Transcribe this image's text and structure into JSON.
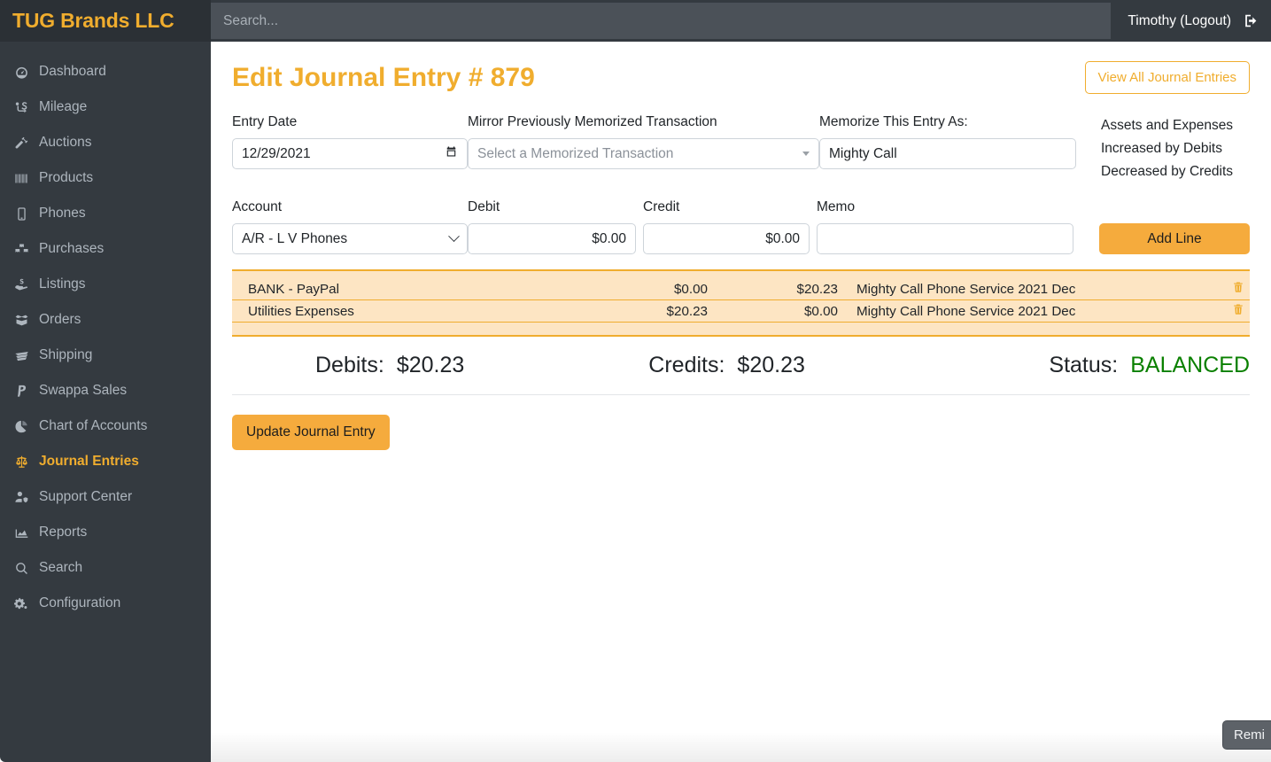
{
  "brand": {
    "name": "TUG Brands LLC"
  },
  "sidebar": {
    "items": [
      {
        "label": "Dashboard",
        "icon": "gauge-icon",
        "active": false
      },
      {
        "label": "Mileage",
        "icon": "route-icon",
        "active": false
      },
      {
        "label": "Auctions",
        "icon": "gavel-icon",
        "active": false
      },
      {
        "label": "Products",
        "icon": "barcode-icon",
        "active": false
      },
      {
        "label": "Phones",
        "icon": "mobile-phone-icon",
        "active": false
      },
      {
        "label": "Purchases",
        "icon": "boxes-icon",
        "active": false
      },
      {
        "label": "Listings",
        "icon": "hand-holding-usd-icon",
        "active": false
      },
      {
        "label": "Orders",
        "icon": "open-box-icon",
        "active": false
      },
      {
        "label": "Shipping",
        "icon": "mail-envelope-icon",
        "active": false
      },
      {
        "label": "Swappa Sales",
        "icon": "paypal-p-icon",
        "active": false
      },
      {
        "label": "Chart of Accounts",
        "icon": "pie-chart-icon",
        "active": false
      },
      {
        "label": "Journal Entries",
        "icon": "balance-scale-icon",
        "active": true
      },
      {
        "label": "Support Center",
        "icon": "user-shield-icon",
        "active": false
      },
      {
        "label": "Reports",
        "icon": "chart-area-icon",
        "active": false
      },
      {
        "label": "Search",
        "icon": "search-icon",
        "active": false
      },
      {
        "label": "Configuration",
        "icon": "gears-icon",
        "active": false
      }
    ]
  },
  "topbar": {
    "search_placeholder": "Search...",
    "search_value": "",
    "user_label": "Timothy (Logout)",
    "logout_icon": "sign-out-icon"
  },
  "page": {
    "title": "Edit Journal Entry # 879",
    "view_all_label": "View All Journal Entries"
  },
  "form": {
    "entry_date_label": "Entry Date",
    "entry_date_value": "12/29/2021",
    "mirror_label": "Mirror Previously Memorized Transaction",
    "mirror_placeholder": "Select a Memorized Transaction",
    "memorize_label": "Memorize This Entry As:",
    "memorize_value": "Mighty Call",
    "note_lines": [
      "Assets and Expenses",
      "Increased by Debits",
      "Decreased by Credits"
    ],
    "account_label": "Account",
    "account_value": "A/R - L V Phones",
    "debit_label": "Debit",
    "debit_value": "$0.00",
    "credit_label": "Credit",
    "credit_value": "$0.00",
    "memo_label": "Memo",
    "memo_value": "",
    "add_line_label": "Add Line"
  },
  "lines": [
    {
      "account": "BANK - PayPal",
      "debit": "$0.00",
      "credit": "$20.23",
      "memo": "Mighty Call Phone Service 2021 Dec",
      "delete_icon": "trash-icon"
    },
    {
      "account": "Utilities Expenses",
      "debit": "$20.23",
      "credit": "$0.00",
      "memo": "Mighty Call Phone Service 2021 Dec",
      "delete_icon": "trash-icon"
    }
  ],
  "totals": {
    "debits_label": "Debits:",
    "debits_value": "$20.23",
    "credits_label": "Credits:",
    "credits_value": "$20.23",
    "status_label": "Status:",
    "status_value": "BALANCED",
    "status_color": "#0a8000"
  },
  "actions": {
    "update_label": "Update Journal Entry"
  },
  "floating": {
    "label": "Remi"
  },
  "colors": {
    "accent": "#f0ad2e",
    "accent_solid": "#f5ab3d",
    "sidebar_bg": "#343a40",
    "brand_bg": "#2b3035",
    "line_bg": "#fde5c3"
  }
}
